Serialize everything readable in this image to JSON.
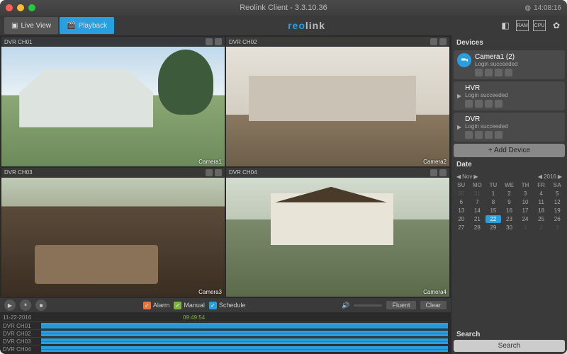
{
  "window": {
    "title": "Reolink Client - 3.3.10.36",
    "clock": "14:08:16"
  },
  "toolbar": {
    "live_view": "Live View",
    "playback": "Playback",
    "brand_a": "reo",
    "brand_b": "link"
  },
  "cameras": [
    {
      "ch": "DVR CH01",
      "label": "Camera1"
    },
    {
      "ch": "DVR CH02",
      "label": "Camera2"
    },
    {
      "ch": "DVR CH03",
      "label": "Camera3"
    },
    {
      "ch": "DVR CH04",
      "label": "Camera4"
    }
  ],
  "controls": {
    "alarm": "Alarm",
    "manual": "Manual",
    "schedule": "Schedule",
    "fluent": "Fluent",
    "clear": "Clear"
  },
  "timeline": {
    "date": "11-22-2016",
    "time": "09:49:54",
    "rows": [
      "DVR CH01",
      "DVR CH02",
      "DVR CH03",
      "DVR CH04"
    ]
  },
  "sidebar": {
    "devices_hdr": "Devices",
    "devices": [
      {
        "name": "Camera1 (2)",
        "status": "Login succeeded"
      },
      {
        "name": "HVR",
        "status": "Login succeeded"
      },
      {
        "name": "DVR",
        "status": "Login succeeded"
      }
    ],
    "add_device": "+  Add Device",
    "date_hdr": "Date",
    "search_hdr": "Search",
    "search_btn": "Search"
  },
  "calendar": {
    "month": "Nov",
    "year": "2016",
    "dow": [
      "SU",
      "MO",
      "TU",
      "WE",
      "TH",
      "FR",
      "SA"
    ],
    "cells": [
      {
        "d": "30",
        "o": true
      },
      {
        "d": "31",
        "o": true
      },
      {
        "d": "1"
      },
      {
        "d": "2"
      },
      {
        "d": "3"
      },
      {
        "d": "4"
      },
      {
        "d": "5"
      },
      {
        "d": "6"
      },
      {
        "d": "7"
      },
      {
        "d": "8"
      },
      {
        "d": "9"
      },
      {
        "d": "10"
      },
      {
        "d": "11"
      },
      {
        "d": "12"
      },
      {
        "d": "13"
      },
      {
        "d": "14"
      },
      {
        "d": "15"
      },
      {
        "d": "16"
      },
      {
        "d": "17"
      },
      {
        "d": "18"
      },
      {
        "d": "19"
      },
      {
        "d": "20"
      },
      {
        "d": "21"
      },
      {
        "d": "22",
        "t": true
      },
      {
        "d": "23"
      },
      {
        "d": "24"
      },
      {
        "d": "25"
      },
      {
        "d": "26"
      },
      {
        "d": "27"
      },
      {
        "d": "28"
      },
      {
        "d": "29"
      },
      {
        "d": "30"
      },
      {
        "d": "1",
        "o": true
      },
      {
        "d": "2",
        "o": true
      },
      {
        "d": "3",
        "o": true
      }
    ]
  }
}
